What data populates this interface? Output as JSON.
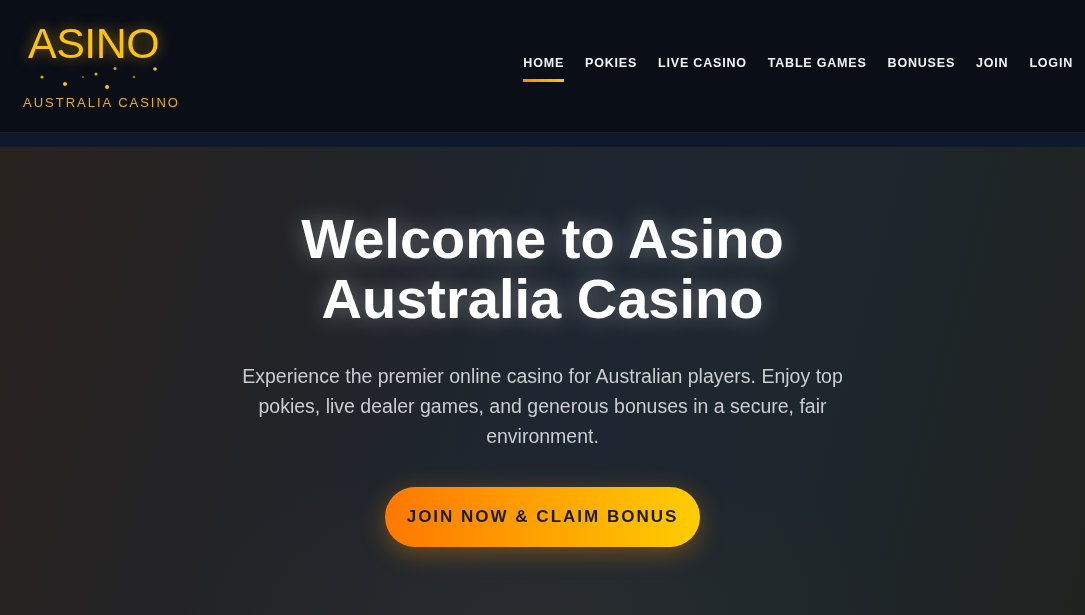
{
  "header": {
    "logo": {
      "title": "ASINO",
      "subtitle": "AUSTRALIA CASINO"
    },
    "nav": [
      {
        "label": "HOME",
        "selected": true
      },
      {
        "label": "POKIES",
        "selected": false
      },
      {
        "label": "LIVE CASINO",
        "selected": false
      },
      {
        "label": "TABLE GAMES",
        "selected": false
      },
      {
        "label": "BONUSES",
        "selected": false
      },
      {
        "label": "JOIN",
        "selected": false
      },
      {
        "label": "LOGIN",
        "selected": false
      }
    ]
  },
  "hero": {
    "heading": "Welcome to Asino Australia Casino",
    "text": "Experience the premier online casino for Australian players. Enjoy top pokies, live dealer games, and generous bonuses in a secure, fair environment.",
    "cta": "JOIN NOW & CLAIM BONUS"
  }
}
